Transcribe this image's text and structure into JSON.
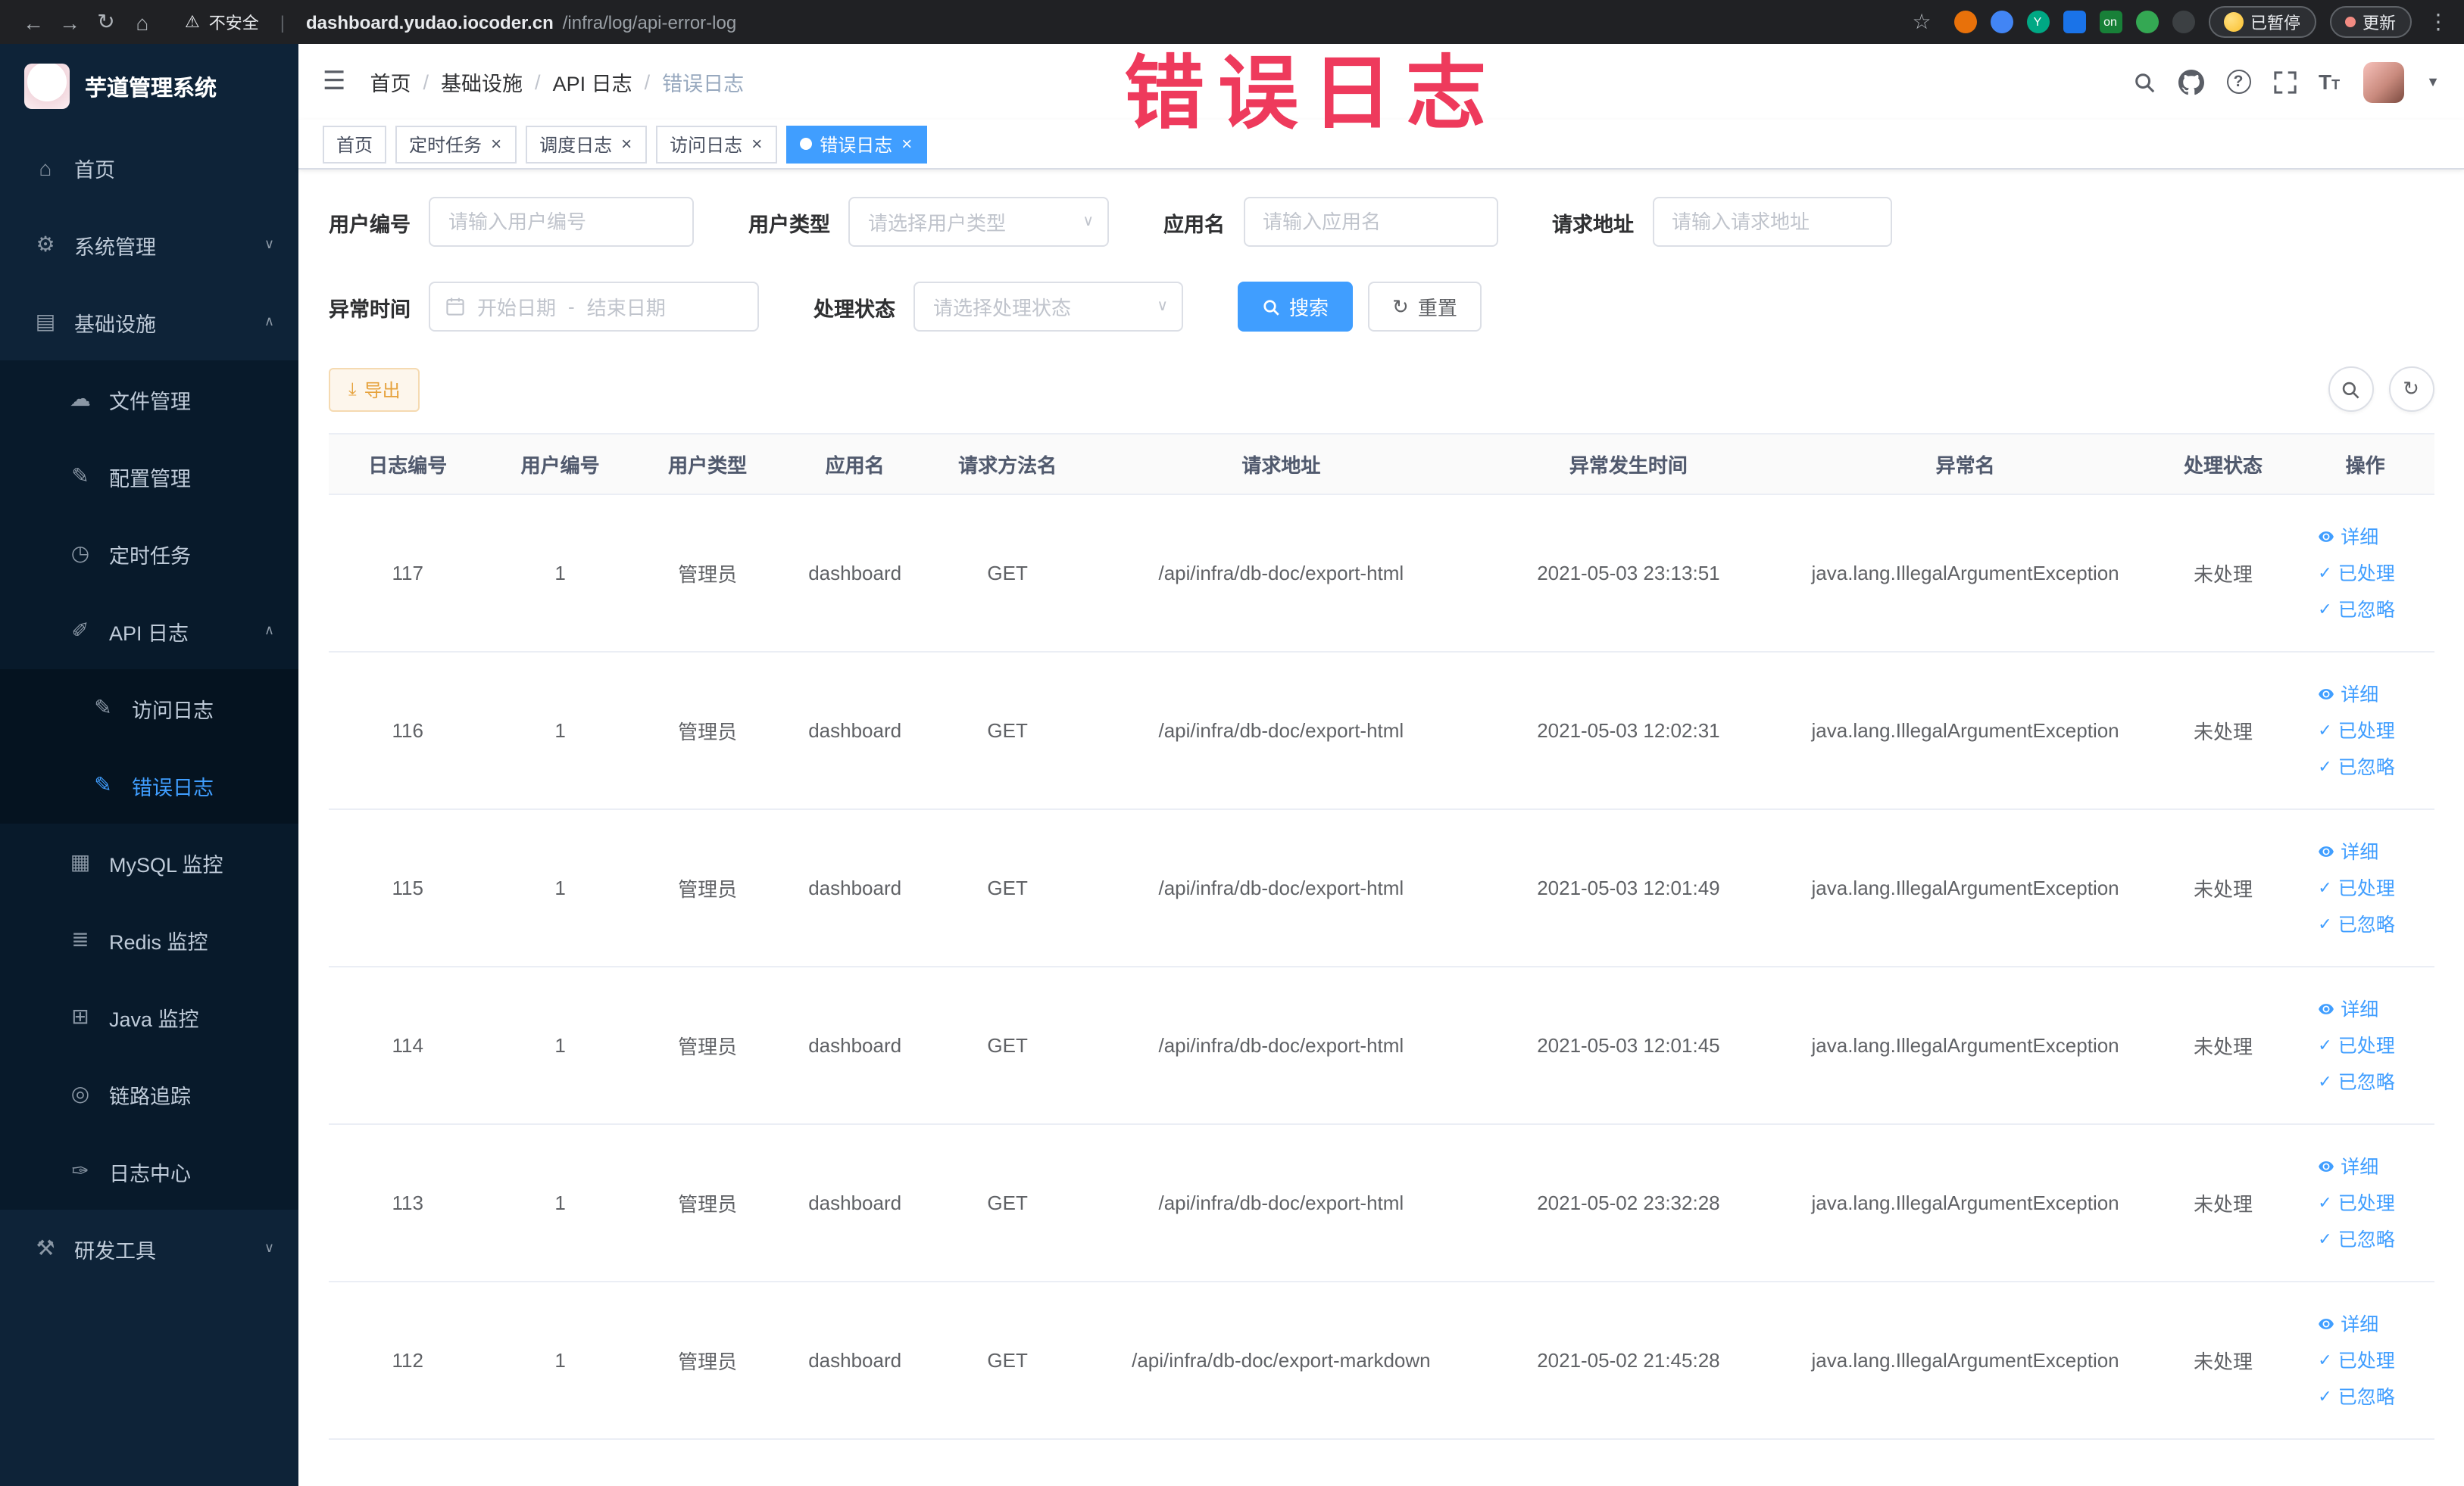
{
  "colors": {
    "primary": "#409eff",
    "annotation_red": "#ee3a5c",
    "sidebar_bg": "#0e2338",
    "chrome_bg": "#202124",
    "warning_orange": "#e6a23c",
    "active_tag_bg": "#409eff"
  },
  "browser_chrome": {
    "security_label": "不安全",
    "url_host": "dashboard.yudao.iocoder.cn",
    "url_path": "/infra/log/api-error-log",
    "extension_badge": "on",
    "paused_label": "已暂停",
    "update_label": "更新"
  },
  "annotation": {
    "text": "错误日志"
  },
  "sidebar": {
    "logo_title": "芋道管理系统",
    "items": [
      {
        "key": "home",
        "label": "首页",
        "icon": "⌂",
        "icon_name": "home-icon",
        "depth": 0
      },
      {
        "key": "system-management",
        "label": "系统管理",
        "icon": "⚙",
        "icon_name": "gear-icon",
        "depth": 0,
        "chevron": "down"
      },
      {
        "key": "infrastructure",
        "label": "基础设施",
        "icon": "▤",
        "icon_name": "infrastructure-icon",
        "depth": 0,
        "chevron": "up"
      },
      {
        "key": "file-management",
        "label": "文件管理",
        "icon": "☁",
        "icon_name": "cloud-file-icon",
        "depth": 1
      },
      {
        "key": "config-management",
        "label": "配置管理",
        "icon": "✎",
        "icon_name": "config-edit-icon",
        "depth": 1
      },
      {
        "key": "scheduled-tasks",
        "label": "定时任务",
        "icon": "◷",
        "icon_name": "timer-icon",
        "depth": 1
      },
      {
        "key": "api-logs",
        "label": "API 日志",
        "icon": "✐",
        "icon_name": "api-log-icon",
        "depth": 1,
        "chevron": "up"
      },
      {
        "key": "access-log",
        "label": "访问日志",
        "icon": "✎",
        "icon_name": "access-log-icon",
        "depth": 2
      },
      {
        "key": "error-log",
        "label": "错误日志",
        "icon": "✎",
        "icon_name": "error-log-icon",
        "depth": 2,
        "active": true
      },
      {
        "key": "mysql-monitor",
        "label": "MySQL 监控",
        "icon": "▦",
        "icon_name": "mysql-monitor-icon",
        "depth": 1
      },
      {
        "key": "redis-monitor",
        "label": "Redis 监控",
        "icon": "≣",
        "icon_name": "redis-monitor-icon",
        "depth": 1
      },
      {
        "key": "java-monitor",
        "label": "Java 监控",
        "icon": "⊞",
        "icon_name": "java-monitor-icon",
        "depth": 1
      },
      {
        "key": "tracing",
        "label": "链路追踪",
        "icon": "◎",
        "icon_name": "tracing-eye-icon",
        "depth": 1
      },
      {
        "key": "log-center",
        "label": "日志中心",
        "icon": "✑",
        "icon_name": "log-center-icon",
        "depth": 1
      },
      {
        "key": "dev-tools",
        "label": "研发工具",
        "icon": "⚒",
        "icon_name": "dev-tools-icon",
        "depth": 0,
        "chevron": "down"
      }
    ]
  },
  "navbar": {
    "breadcrumb": [
      "首页",
      "基础设施",
      "API 日志",
      "错误日志"
    ]
  },
  "tags": [
    {
      "key": "home",
      "label": "首页",
      "closable": false,
      "active": false
    },
    {
      "key": "scheduled-tasks",
      "label": "定时任务",
      "closable": true,
      "active": false
    },
    {
      "key": "schedule-log",
      "label": "调度日志",
      "closable": true,
      "active": false
    },
    {
      "key": "access-log",
      "label": "访问日志",
      "closable": true,
      "active": false
    },
    {
      "key": "error-log",
      "label": "错误日志",
      "closable": true,
      "active": true
    }
  ],
  "filters": {
    "user_id": {
      "label": "用户编号",
      "placeholder": "请输入用户编号"
    },
    "user_type": {
      "label": "用户类型",
      "placeholder": "请选择用户类型"
    },
    "app_name": {
      "label": "应用名",
      "placeholder": "请输入应用名"
    },
    "request_url": {
      "label": "请求地址",
      "placeholder": "请输入请求地址"
    },
    "exception_time": {
      "label": "异常时间",
      "start_placeholder": "开始日期",
      "separator": "-",
      "end_placeholder": "结束日期"
    },
    "process_status": {
      "label": "处理状态",
      "placeholder": "请选择处理状态"
    },
    "search_label": "搜索",
    "reset_label": "重置"
  },
  "toolbar": {
    "export_label": "导出"
  },
  "table": {
    "columns": [
      "日志编号",
      "用户编号",
      "用户类型",
      "应用名",
      "请求方法名",
      "请求地址",
      "异常发生时间",
      "异常名",
      "处理状态",
      "操作"
    ],
    "action_labels": [
      "详细",
      "已处理",
      "已忽略"
    ],
    "rows": [
      {
        "log_id": "117",
        "user_id": "1",
        "user_type": "管理员",
        "app_name": "dashboard",
        "method": "GET",
        "url": "/api/infra/db-doc/export-html",
        "time": "2021-05-03 23:13:51",
        "exception": "java.lang.IllegalArgumentException",
        "status": "未处理"
      },
      {
        "log_id": "116",
        "user_id": "1",
        "user_type": "管理员",
        "app_name": "dashboard",
        "method": "GET",
        "url": "/api/infra/db-doc/export-html",
        "time": "2021-05-03 12:02:31",
        "exception": "java.lang.IllegalArgumentException",
        "status": "未处理"
      },
      {
        "log_id": "115",
        "user_id": "1",
        "user_type": "管理员",
        "app_name": "dashboard",
        "method": "GET",
        "url": "/api/infra/db-doc/export-html",
        "time": "2021-05-03 12:01:49",
        "exception": "java.lang.IllegalArgumentException",
        "status": "未处理"
      },
      {
        "log_id": "114",
        "user_id": "1",
        "user_type": "管理员",
        "app_name": "dashboard",
        "method": "GET",
        "url": "/api/infra/db-doc/export-html",
        "time": "2021-05-03 12:01:45",
        "exception": "java.lang.IllegalArgumentException",
        "status": "未处理"
      },
      {
        "log_id": "113",
        "user_id": "1",
        "user_type": "管理员",
        "app_name": "dashboard",
        "method": "GET",
        "url": "/api/infra/db-doc/export-html",
        "time": "2021-05-02 23:32:28",
        "exception": "java.lang.IllegalArgumentException",
        "status": "未处理"
      },
      {
        "log_id": "112",
        "user_id": "1",
        "user_type": "管理员",
        "app_name": "dashboard",
        "method": "GET",
        "url": "/api/infra/db-doc/export-markdown",
        "time": "2021-05-02 21:45:28",
        "exception": "java.lang.IllegalArgumentException",
        "status": "未处理"
      }
    ]
  }
}
